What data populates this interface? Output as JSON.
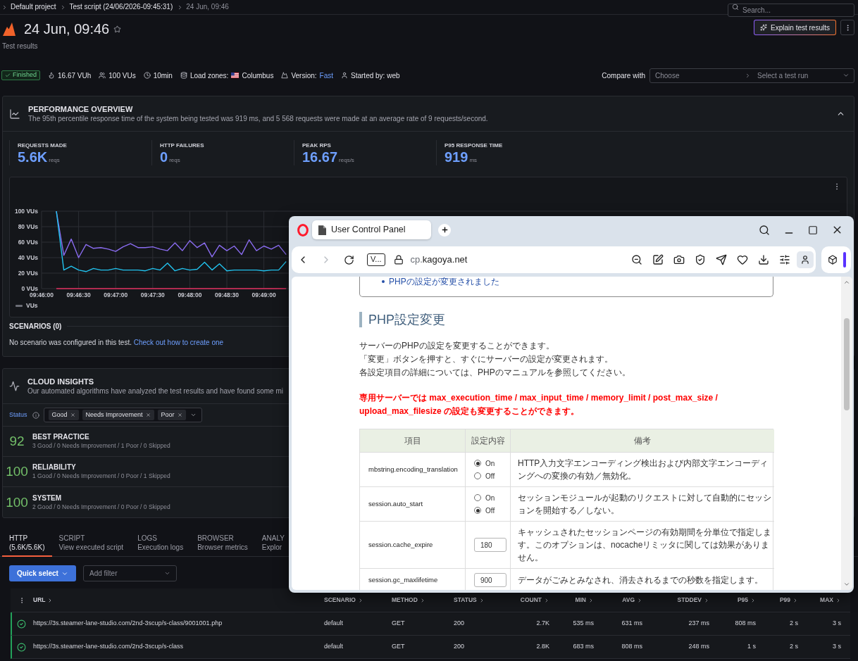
{
  "breadcrumbs": [
    {
      "label": "Default project",
      "current": false
    },
    {
      "label": "Test script (24/06/2026-09:45:31)",
      "current": false
    },
    {
      "label": "24 Jun, 09:46",
      "current": true
    }
  ],
  "search": {
    "placeholder": "Search..."
  },
  "header": {
    "title": "24 Jun, 09:46",
    "starred": false,
    "subtitle": "Test results",
    "explain_button": "Explain test results"
  },
  "run_info": {
    "status": "Finished",
    "items": [
      {
        "kind": "vuh",
        "text": "16.67 VUh"
      },
      {
        "kind": "vus",
        "text": "100 VUs"
      },
      {
        "kind": "duration",
        "text": "10min"
      },
      {
        "kind": "zones",
        "label": "Load zones:",
        "value": "Columbus"
      },
      {
        "kind": "version",
        "label": "Version:",
        "value": "Fast"
      },
      {
        "kind": "starter",
        "text": "Started by: web"
      }
    ],
    "compare": {
      "label": "Compare with",
      "placeholders": [
        "Choose",
        "Select a test run"
      ]
    }
  },
  "performance_overview": {
    "title": "PERFORMANCE OVERVIEW",
    "summary": "The 95th percentile response time of the system being tested was 919 ms, and 5 568 requests were made at an average rate of 9 requests/second.",
    "expanded": true,
    "metrics": [
      {
        "label": "REQUESTS MADE",
        "value": "5.6K",
        "unit": "reqs"
      },
      {
        "label": "HTTP FAILURES",
        "value": "0",
        "unit": "reqs"
      },
      {
        "label": "PEAK RPS",
        "value": "16.67",
        "unit": "reqs/s"
      },
      {
        "label": "P95 RESPONSE TIME",
        "value": "919",
        "unit": "ms"
      }
    ],
    "chart": {
      "chart_data": {
        "type": "line",
        "grid": true,
        "categories": [
          "09:46:00",
          null,
          null,
          null,
          null,
          "09:46:30",
          null,
          null,
          null,
          null,
          "09:47:00",
          null,
          null,
          null,
          null,
          "09:47:30",
          null,
          null,
          null,
          null,
          "09:48:00",
          null,
          null,
          null,
          null,
          "09:48:30",
          null,
          null,
          null,
          null,
          "09:49:00",
          null,
          null,
          null,
          null
        ],
        "yticks": [
          {
            "value": 0,
            "label": "0 VUs"
          },
          {
            "value": 20,
            "label": "20 VUs"
          },
          {
            "value": 40,
            "label": "40 VUs"
          },
          {
            "value": 60,
            "label": "60 VUs"
          },
          {
            "value": 80,
            "label": "80 VUs"
          },
          {
            "value": 100,
            "label": "100 VUs"
          }
        ],
        "ylim": [
          0,
          100
        ],
        "series": [
          {
            "color": "#8a6cf0",
            "values": [
              null,
              null,
              100,
              43,
              64,
              40,
              57,
              52,
              53,
              51,
              48,
              54,
              58,
              53,
              53,
              54,
              51,
              49,
              59,
              49,
              62,
              53,
              59,
              41,
              56,
              49,
              55,
              44,
              63,
              49,
              55,
              51,
              56,
              44,
              null
            ]
          },
          {
            "color": "#22c3ef",
            "values": [
              null,
              null,
              100,
              24,
              29,
              24,
              22,
              26,
              24,
              24,
              26,
              24,
              24,
              24,
              23,
              26,
              24,
              33,
              23,
              26,
              24,
              25,
              34,
              24,
              32,
              23,
              24,
              24,
              24,
              24,
              23,
              24,
              24,
              35,
              null
            ]
          },
          {
            "color": "#e02f5f",
            "values": [
              null,
              null,
              0,
              0,
              0,
              0,
              0,
              0,
              0,
              0,
              0,
              0,
              0,
              0,
              0,
              0,
              0,
              0,
              0,
              0,
              0,
              0,
              0,
              0,
              0,
              0,
              0,
              0,
              0,
              0,
              0,
              0,
              0,
              0,
              null
            ]
          }
        ]
      },
      "legend": [
        "VUs"
      ]
    },
    "scenarios": {
      "title": "SCENARIOS (0)",
      "message": "No scenario was configured in this test.",
      "link": "Check out how to create one"
    }
  },
  "cloud_insights": {
    "title": "CLOUD INSIGHTS",
    "summary": "Our automated algorithms have analyzed the test results and have found some mi",
    "filter": {
      "label": "Status",
      "chips": [
        "Good",
        "Needs Improvement",
        "Poor"
      ]
    },
    "categories": [
      {
        "score": "92",
        "title": "BEST PRACTICE",
        "detail": "3 Good / 0 Needs Improvement / 1 Poor / 0 Skipped"
      },
      {
        "score": "100",
        "title": "RELIABILITY",
        "detail": "1 Good / 0 Needs Improvement / 0 Poor / 1 Skipped"
      },
      {
        "score": "100",
        "title": "SYSTEM",
        "detail": "2 Good / 0 Needs Improvement / 0 Poor / 0 Skipped"
      }
    ]
  },
  "tabs": [
    {
      "title": "HTTP",
      "subtitle": "(5.6K/5.6K)",
      "selected": true
    },
    {
      "title": "SCRIPT",
      "subtitle": "View executed script",
      "selected": false
    },
    {
      "title": "LOGS",
      "subtitle": "Execution logs",
      "selected": false
    },
    {
      "title": "BROWSER",
      "subtitle": "Browser metrics",
      "selected": false
    },
    {
      "title": "ANALY",
      "subtitle": "Explor",
      "selected": false
    }
  ],
  "toolbar": {
    "quick_select": "Quick select",
    "filter": {
      "placeholder": "Add filter"
    }
  },
  "table": {
    "columns": [
      "URL",
      "SCENARIO",
      "METHOD",
      "STATUS",
      "COUNT",
      "MIN",
      "AVG",
      "STDDEV",
      "P95",
      "P99",
      "MAX"
    ],
    "rows": [
      {
        "passed": true,
        "cells": [
          "https://3s.steamer-lane-studio.com/2nd-3scup/s-class/9001001.php",
          "default",
          "GET",
          "200",
          "2.7K",
          "535 ms",
          "631 ms",
          "237 ms",
          "808 ms",
          "2 s",
          "3 s"
        ]
      },
      {
        "passed": true,
        "cells": [
          "https://3s.steamer-lane-studio.com/2nd-3scup/s-class",
          "default",
          "GET",
          "200",
          "2.8K",
          "683 ms",
          "808 ms",
          "248 ms",
          "1 s",
          "2 s",
          "3 s"
        ]
      }
    ]
  },
  "browser": {
    "tab_title": "User Control Panel",
    "navigation": {
      "back_disabled": false,
      "forward_disabled": true
    },
    "badge": "V...",
    "url_prefix": "cp.",
    "url_host": "kagoya.net",
    "page": {
      "notice": [
        "PHPの設定が変更されました"
      ],
      "heading": "PHP設定変更",
      "paragraphs": [
        "サーバーのPHPの設定を変更することができます。",
        "「変更」ボタンを押すと、すぐにサーバーの設定が変更されます。",
        "各設定項目の詳細については、PHPのマニュアルを参照してください。"
      ],
      "warning": "専用サーバーでは max_execution_time / max_input_time / memory_limit / post_max_size / upload_max_filesize の設定も変更することができます。",
      "table": {
        "columns": [
          "項目",
          "設定内容",
          "備考"
        ],
        "rows": [
          {
            "name": "mbstring.encoding_translation",
            "control": {
              "kind": "radio",
              "options": [
                {
                  "label": "On",
                  "selected": true
                },
                {
                  "label": "Off",
                  "selected": false
                }
              ]
            },
            "note": "HTTP入力文字エンコーディング検出および内部文字エンコーディングへの変換の有効／無効化。"
          },
          {
            "name": "session.auto_start",
            "control": {
              "kind": "radio",
              "options": [
                {
                  "label": "On",
                  "selected": false
                },
                {
                  "label": "Off",
                  "selected": true
                }
              ]
            },
            "note": "セッションモジュールが起動のリクエストに対して自動的にセッションを開始する／しない。"
          },
          {
            "name": "session.cache_expire",
            "control": {
              "kind": "number",
              "value": "180"
            },
            "note": "キャッシュされたセッションページの有効期間を分単位で指定します。このオプションは、nocacheリミッタに関しては効果がありません。"
          },
          {
            "name": "session.gc_maxlifetime",
            "control": {
              "kind": "number",
              "value": "900"
            },
            "note": "データがごみとみなされ、消去されるまでの秒数を指定します。"
          }
        ]
      }
    }
  }
}
